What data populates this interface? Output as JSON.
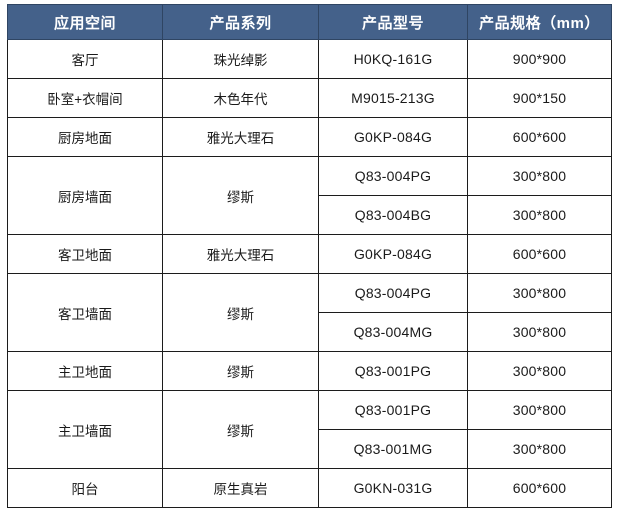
{
  "table": {
    "columns": [
      {
        "label": "应用空间",
        "key": "space"
      },
      {
        "label": "产品系列",
        "key": "series"
      },
      {
        "label": "产品型号",
        "key": "model"
      },
      {
        "label": "产品规格（mm）",
        "key": "size",
        "label_main": "产品规格",
        "label_unit": "（mm）"
      }
    ],
    "header_bg": "#44618A",
    "header_text_color": "#ffffff",
    "border_color": "#1c1c1c",
    "body_bg": "#ffffff",
    "body_text_color": "#1a1a1a",
    "groups": [
      {
        "space": "客厅",
        "series": "珠光绰影",
        "rows": [
          {
            "model": "H0KQ-161G",
            "size": "900*900"
          }
        ]
      },
      {
        "space": "卧室+衣帽间",
        "series": "木色年代",
        "rows": [
          {
            "model": "M9015-213G",
            "size": "900*150"
          }
        ]
      },
      {
        "space": "厨房地面",
        "series": "雅光大理石",
        "rows": [
          {
            "model": "G0KP-084G",
            "size": "600*600"
          }
        ]
      },
      {
        "space": "厨房墙面",
        "series": "缪斯",
        "rows": [
          {
            "model": "Q83-004PG",
            "size": "300*800"
          },
          {
            "model": "Q83-004BG",
            "size": "300*800"
          }
        ]
      },
      {
        "space": "客卫地面",
        "series": "雅光大理石",
        "rows": [
          {
            "model": "G0KP-084G",
            "size": "600*600"
          }
        ]
      },
      {
        "space": "客卫墙面",
        "series": "缪斯",
        "rows": [
          {
            "model": "Q83-004PG",
            "size": "300*800"
          },
          {
            "model": "Q83-004MG",
            "size": "300*800"
          }
        ]
      },
      {
        "space": "主卫地面",
        "series": "缪斯",
        "rows": [
          {
            "model": "Q83-001PG",
            "size": "300*800"
          }
        ]
      },
      {
        "space": "主卫墙面",
        "series": "缪斯",
        "rows": [
          {
            "model": "Q83-001PG",
            "size": "300*800"
          },
          {
            "model": "Q83-001MG",
            "size": "300*800"
          }
        ]
      },
      {
        "space": "阳台",
        "series": "原生真岩",
        "rows": [
          {
            "model": "G0KN-031G",
            "size": "600*600"
          }
        ]
      }
    ]
  }
}
